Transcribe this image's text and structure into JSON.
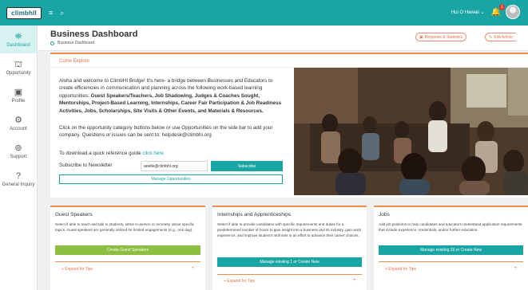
{
  "topbar": {
    "logo_text": "climbhll",
    "user_name": "Hui O Hawaii",
    "notification_count": "1"
  },
  "sidebar": {
    "items": [
      {
        "label": "Dashboard",
        "icon": "dashboard-icon",
        "glyph": "⛯"
      },
      {
        "label": "Opportunity",
        "icon": "opportunity-icon",
        "glyph": "⛫"
      },
      {
        "label": "Profile",
        "icon": "profile-icon",
        "glyph": "▣"
      },
      {
        "label": "Account",
        "icon": "account-gear-icon",
        "glyph": "⚙"
      },
      {
        "label": "Support",
        "icon": "support-icon",
        "glyph": "⊚"
      },
      {
        "label": "General Inquiry",
        "icon": "question-icon",
        "glyph": "?"
      }
    ]
  },
  "header": {
    "title": "Business Dashboard",
    "breadcrumb": "Business Dashboard",
    "btn_requests": "Requests & Statistics",
    "btn_edit": "Edit Article"
  },
  "explore": {
    "title": "Come Explore",
    "intro_plain": "Aloha and welcome to ClimbHI Bridge! It's here- a bridge between Businesses and Educators to create efficiencies in communication and planning across the following work-based learning opportunities:",
    "intro_bold": "Guest Speakers/Teachers, Job Shadowing, Judges & Coaches Sought, Mentorships, Project-Based Learning, Internships, Career Fair Participation & Job Readiness Activities, Jobs, Scholarships, Site Visits & Other Events, and Materials & Resources.",
    "click_text": "Click on the opportunity category buttons below or use Opportunities on the side bar to add your company. Questions or issues can be sent to:",
    "email": "helpdesk@climbhi.org",
    "guide_text": "To download a quick reference guide",
    "guide_link": "click here.",
    "subscribe_label": "Subscribe to Newsletter",
    "subscribe_value": "anelle@climbhi.org",
    "subscribe_button": "Subscribe",
    "manage_button": "Manage Opportunities"
  },
  "panels": [
    {
      "title": "Guest Speakers",
      "desc": "Select if able to teach and talk to students, either in-person or remotely, about specific topics. Guest speakers are generally utilized for limited engagements (e.g., one day).",
      "button": "Create Guest Speakers",
      "tips": "+ Expand for Tips"
    },
    {
      "title": "Internships and Apprenticeships",
      "desc": "Select if able to provide candidates with specific requirements and duties for a predetermined number of hours to gain insight into a business and its industry, gain work experience, and improve student's skill sets in an effort to advance their career choices.",
      "button": "Manage existing 1 or Create New",
      "tips": "+ Expand for Tips"
    },
    {
      "title": "Jobs",
      "desc": "Add job positions to help candidates and educators understand application requirements that include experience, credentials, and/or further education.",
      "button": "Manage existing 20 or Create New",
      "tips": "+ Expand for Tips"
    }
  ],
  "colors": {
    "brand_teal": "#1aa5a5",
    "accent_orange": "#f08c4d",
    "green_button": "#8cbf3f"
  }
}
